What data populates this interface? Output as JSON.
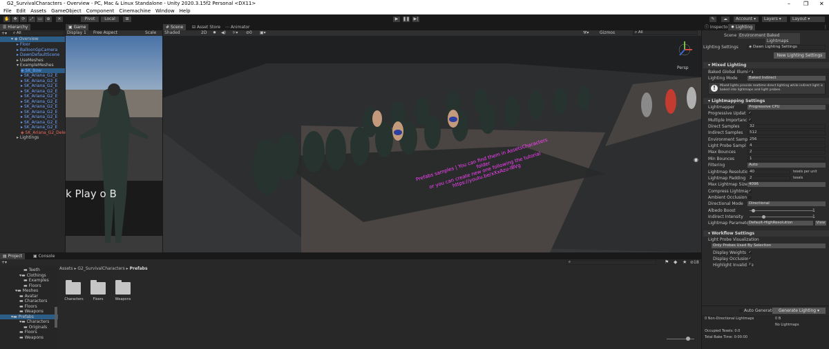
{
  "window": {
    "title": "G2_SurvivalCharacters - Overview - PC, Mac & Linux Standalone - Unity 2020.3.15f2 Personal <DX11>"
  },
  "menu": [
    "File",
    "Edit",
    "Assets",
    "GameObject",
    "Component",
    "Cinemachine",
    "Window",
    "Help"
  ],
  "toolbar": {
    "pivot": "Pivot",
    "local": "Local",
    "account": "Account",
    "layers": "Layers",
    "layout": "Layout"
  },
  "hierarchy": {
    "tab": "Hierarchy",
    "search": "All",
    "scene": "Overview",
    "items": [
      "Floor",
      "BalloonGpCamera",
      "DawnDefaultScene",
      "UseMeshes",
      "ExampleMeshes",
      "SK_Bow",
      "SK_Ariana_G2_E",
      "SK_Ariana_G2_E",
      "SK_Ariana_G2_E",
      "SK_Ariana_G2_E",
      "SK_Ariana_G2_E",
      "SK_Ariana_G2_E",
      "SK_Ariana_G2_E",
      "SK_Ariana_G2_E",
      "SK_Ariana_G2_E",
      "SK_Ariana_G2_E",
      "SK_Ariana_G2_E",
      "SK_Ariana_G2_Dele",
      "Lightings"
    ]
  },
  "game": {
    "tab": "Game",
    "display": "Display 1",
    "aspect": "Free Aspect",
    "scale": "Scale",
    "overlay_text": "k Play o B"
  },
  "scene": {
    "tabs": [
      "Scene",
      "Asset Store",
      "Animator"
    ],
    "shading": "Shaded",
    "mode": "2D",
    "gizmos": "Gizmos",
    "search": "All",
    "persp": "Persp",
    "note_lines": [
      "Prefabs samples | You can find them in AssetsCharacters folder",
      "or you can create new one following the tutorial",
      "https://youtu.be/xXxAzu-IBVg"
    ]
  },
  "project": {
    "tabs": [
      "Project",
      "Console"
    ],
    "tree": [
      "Teeth",
      "Clothings",
      "Examples",
      "Floors",
      "Meshes",
      "Avatar",
      "Characters",
      "Floors",
      "Weapons",
      "Prefabs",
      "Characters",
      "Originals",
      "Floors",
      "Weapons"
    ],
    "breadcrumb": [
      "Assets",
      "G2_SurvivalCharacters",
      "Prefabs"
    ],
    "folders": [
      "Characters",
      "Floors",
      "Weapons"
    ],
    "count": "18"
  },
  "inspector": {
    "tabs": [
      "Inspector",
      "Lighting"
    ],
    "subtabs": [
      "Scene",
      "Environment",
      "Baked Lightmaps"
    ],
    "settings_label": "Lighting Settings",
    "settings_value": "Dawn Lighting Settings",
    "new_button": "New Lighting Settings",
    "mixed": {
      "header": "Mixed Lighting",
      "baked_gi": "Baked Global Illumina",
      "mode_label": "Lighting Mode",
      "mode_value": "Baked Indirect",
      "info": "Mixed lights provide realtime direct lighting while indirect light is baked into lightmaps and light probes."
    },
    "lightmapping": {
      "header": "Lightmapping Settings",
      "rows": [
        {
          "label": "Lightmapper",
          "value": "Progressive CPU",
          "kind": "dropdown"
        },
        {
          "label": "Progressive Updat",
          "value": "✓",
          "kind": "check"
        },
        {
          "label": "Multiple Importanc",
          "value": "✓",
          "kind": "check"
        },
        {
          "label": "Direct Samples",
          "value": "32",
          "kind": "field"
        },
        {
          "label": "Indirect Samples",
          "value": "512",
          "kind": "field"
        },
        {
          "label": "Environment Samp",
          "value": "256",
          "kind": "field"
        },
        {
          "label": "Light Probe Sampl",
          "value": "4",
          "kind": "field"
        },
        {
          "label": "Max Bounces",
          "value": "2",
          "kind": "field"
        },
        {
          "label": "Min Bounces",
          "value": "1",
          "kind": "field"
        },
        {
          "label": "Filtering",
          "value": "Auto",
          "kind": "dropdown"
        },
        {
          "label": "Lightmap Resolution",
          "value": "40",
          "kind": "field",
          "unit": "texels per unit"
        },
        {
          "label": "Lightmap Padding",
          "value": "2",
          "kind": "field",
          "unit": "texels"
        },
        {
          "label": "Max Lightmap Size",
          "value": "4096",
          "kind": "dropdown"
        },
        {
          "label": "Compress Lightmaps",
          "value": "✓",
          "kind": "check"
        },
        {
          "label": "Ambient Occlusion",
          "value": "",
          "kind": "check"
        },
        {
          "label": "Directional Mode",
          "value": "Directional",
          "kind": "dropdown"
        },
        {
          "label": "Albedo Boost",
          "value": "1",
          "kind": "slider",
          "fraction": 0.05
        },
        {
          "label": "Indirect Intensity",
          "value": "1",
          "kind": "slider",
          "fraction": 0.22
        },
        {
          "label": "Lightmap Parameters",
          "value": "Default-HighResolution",
          "kind": "dropdown",
          "extra": "View"
        }
      ]
    },
    "workflow": {
      "header": "Workflow Settings",
      "probe_label": "Light Probe Visualization",
      "probe_value": "Only Probes Used By Selection",
      "rows": [
        {
          "label": "Display Weights",
          "value": "✓"
        },
        {
          "label": "Display Occlusion",
          "value": "✓"
        },
        {
          "label": "Highlight Invalid Ce",
          "value": "✓"
        }
      ]
    },
    "auto_generate": "Auto Generate",
    "generate_button": "Generate Lighting",
    "stats": {
      "non_directional": "0 Non-Directional Lightmaps",
      "size": "0 B",
      "no_lightmaps": "No Lightmaps",
      "occupied": "Occupied Texels: 0.0",
      "bake_time": "Total Bake Time: 0:00:00"
    }
  }
}
